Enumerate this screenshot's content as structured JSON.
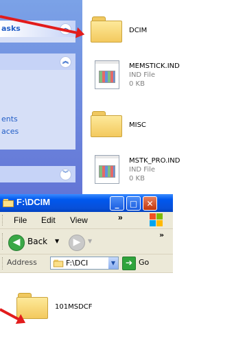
{
  "top_window": {
    "task_pane": {
      "header_1": "asks",
      "link_1": "ents",
      "link_2": "aces"
    },
    "files": [
      {
        "name": "DCIM",
        "type": "folder"
      },
      {
        "name": "MEMSTICK.IND",
        "type": "file",
        "kind": "IND File",
        "size": "0 KB"
      },
      {
        "name": "MISC",
        "type": "folder"
      },
      {
        "name": "MSTK_PRO.IND",
        "type": "file",
        "kind": "IND File",
        "size": "0 KB"
      }
    ]
  },
  "bottom_window": {
    "title": "F:\\DCIM",
    "controls": {
      "minimize": "_",
      "maximize": "□",
      "close": "✕"
    },
    "menu": {
      "file": "File",
      "edit": "Edit",
      "view": "View",
      "more": "»"
    },
    "toolbar": {
      "back": "Back",
      "more": "»"
    },
    "address": {
      "label": "Address",
      "value": "F:\\DCI",
      "go": "Go"
    },
    "files": [
      {
        "name": "101MSDCF",
        "type": "folder"
      }
    ]
  },
  "colors": {
    "arrow": "#e21c1c",
    "titlebar": "#0058ee",
    "task_pane": "#6f8fe0"
  }
}
